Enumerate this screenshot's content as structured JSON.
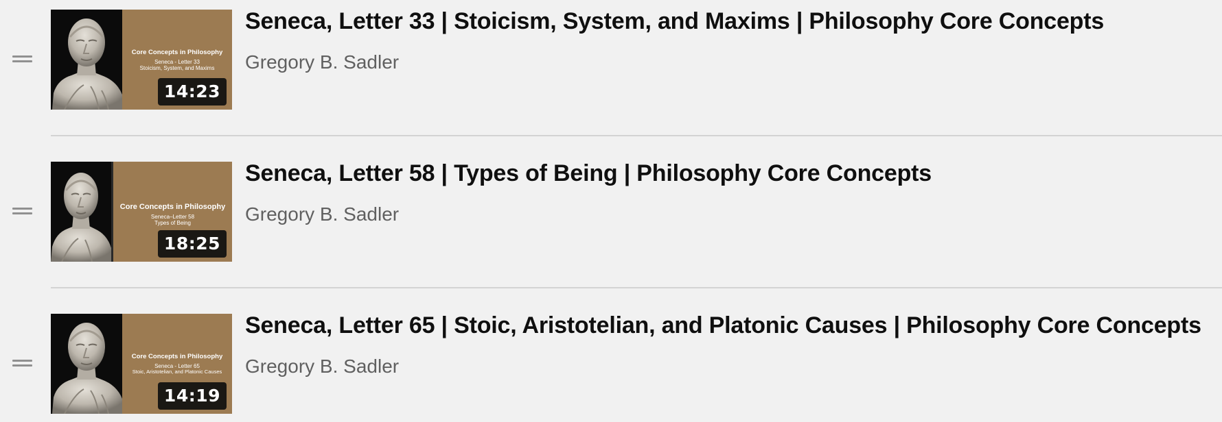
{
  "playlist": {
    "items": [
      {
        "title": "Seneca, Letter 33 | Stoicism, System, and Maxims | Philosophy Core Concepts",
        "channel": "Gregory B. Sadler",
        "duration": "14:23",
        "thumbnail": {
          "heading": "Core Concepts in Philosophy",
          "line1": "Seneca - Letter 33",
          "line2": "Stoicism, System, and Maxims"
        }
      },
      {
        "title": "Seneca, Letter 58 | Types of Being | Philosophy Core Concepts",
        "channel": "Gregory B. Sadler",
        "duration": "18:25",
        "thumbnail": {
          "heading": "Core Concepts in Philosophy",
          "line1": "Seneca–Letter 58",
          "line2": "Types of Being"
        }
      },
      {
        "title": "Seneca, Letter 65 | Stoic, Aristotelian, and Platonic Causes | Philosophy Core Concepts",
        "channel": "Gregory B. Sadler",
        "duration": "14:19",
        "thumbnail": {
          "heading": "Core Concepts in Philosophy",
          "line1": "Seneca - Letter 65",
          "line2": "Stoic, Aristotelian, and Platonic Causes"
        }
      }
    ]
  },
  "colors": {
    "background": "#f1f1f1",
    "thumbnail_tan": "#9c7b52",
    "title_text": "#0f0f0f",
    "channel_text": "#606060",
    "divider": "#d3d3d3",
    "duration_badge": "#0f0f0f"
  },
  "icons": {
    "drag_handle": "drag-handle-icon"
  }
}
